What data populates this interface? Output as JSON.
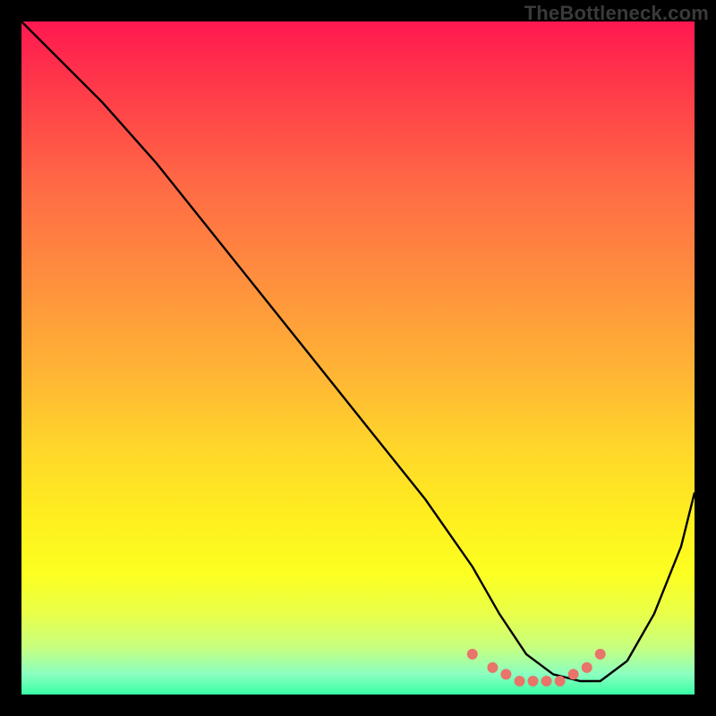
{
  "watermark": "TheBottleneck.com",
  "chart_data": {
    "type": "line",
    "title": "",
    "xlabel": "",
    "ylabel": "",
    "xlim": [
      0,
      100
    ],
    "ylim": [
      0,
      100
    ],
    "series": [
      {
        "name": "curve",
        "color": "#000000",
        "x": [
          0,
          5,
          12,
          20,
          28,
          36,
          44,
          52,
          60,
          67,
          71,
          75,
          79,
          83,
          86,
          90,
          94,
          98,
          100
        ],
        "y": [
          100,
          95,
          88,
          79,
          69,
          59,
          49,
          39,
          29,
          19,
          12,
          6,
          3,
          2,
          2,
          5,
          12,
          22,
          30
        ]
      },
      {
        "name": "dots",
        "color": "#e9746a",
        "x": [
          67,
          70,
          72,
          74,
          76,
          78,
          80,
          82,
          84,
          86
        ],
        "y": [
          6,
          4,
          3,
          2,
          2,
          2,
          2,
          3,
          4,
          6
        ]
      }
    ],
    "gradient_stops": [
      {
        "pos": 0,
        "color": "#ff1850"
      },
      {
        "pos": 10,
        "color": "#ff3a49"
      },
      {
        "pos": 24,
        "color": "#ff6945"
      },
      {
        "pos": 38,
        "color": "#ff8e3e"
      },
      {
        "pos": 52,
        "color": "#ffb435"
      },
      {
        "pos": 64,
        "color": "#ffd82a"
      },
      {
        "pos": 74,
        "color": "#ffef1f"
      },
      {
        "pos": 82,
        "color": "#fcff21"
      },
      {
        "pos": 88,
        "color": "#e9ff49"
      },
      {
        "pos": 93,
        "color": "#c7ff80"
      },
      {
        "pos": 97,
        "color": "#8affc0"
      },
      {
        "pos": 100,
        "color": "#38ffa3"
      }
    ]
  }
}
